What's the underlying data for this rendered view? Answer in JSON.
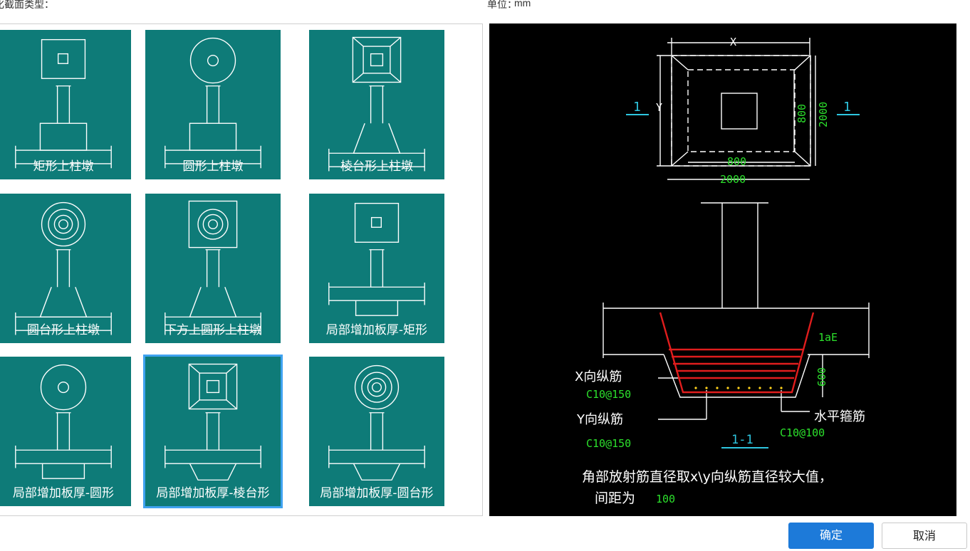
{
  "header": {
    "type_label": "化截面类型：",
    "unit_label": "单位：",
    "unit_value": "mm"
  },
  "types": [
    {
      "label": "矩形上柱墩",
      "top": "square",
      "base": "rect",
      "selected": false
    },
    {
      "label": "圆形上柱墩",
      "top": "circle",
      "base": "rect",
      "selected": false
    },
    {
      "label": "棱台形上柱墩",
      "top": "frustum",
      "base": "trap",
      "selected": false
    },
    {
      "label": "圆台形上柱墩",
      "top": "rings",
      "base": "trap",
      "selected": false
    },
    {
      "label": "下方上圆形上柱墩",
      "top": "squarecircle",
      "base": "trap",
      "selected": false
    },
    {
      "label": "局部增加板厚-矩形",
      "top": "square",
      "base": "below-rect",
      "selected": false
    },
    {
      "label": "局部增加板厚-圆形",
      "top": "circle",
      "base": "below-rect",
      "selected": false
    },
    {
      "label": "局部增加板厚-棱台形",
      "top": "frustum",
      "base": "below-trap",
      "selected": true
    },
    {
      "label": "局部增加板厚-圆台形",
      "top": "rings",
      "base": "below-trap",
      "selected": false
    }
  ],
  "preview": {
    "dim_x": "X",
    "dim_y": "Y",
    "section_left": "1",
    "section_right": "1",
    "inner_w": "800",
    "outer_w": "2000",
    "inner_h": "800",
    "outer_h": "2000",
    "lae": "1aE",
    "depth": "600",
    "x_bar_label": "X向纵筋",
    "x_bar_value": "C10@150",
    "y_bar_label": "Y向纵筋",
    "y_bar_value": "C10@150",
    "stirrup_label": "水平箍筋",
    "stirrup_value": "C10@100",
    "section_title": "1-1",
    "note_line1": "角部放射筋直径取x\\y向纵筋直径较大值，",
    "note_line2_label": "间距为",
    "note_line2_value": "100"
  },
  "buttons": {
    "ok": "确定",
    "cancel": "取消"
  }
}
